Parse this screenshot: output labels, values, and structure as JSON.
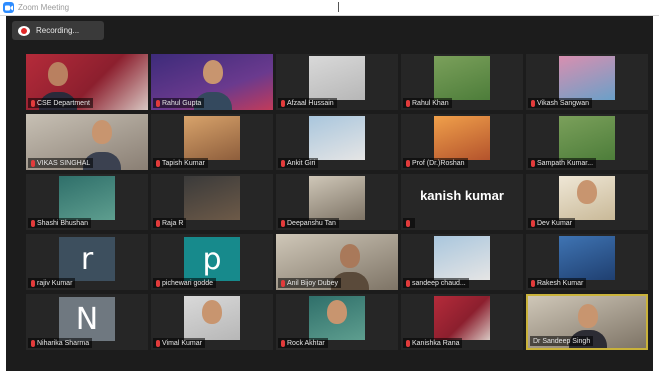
{
  "window": {
    "title": "Zoom Meeting"
  },
  "recording": {
    "label": "Recording..."
  },
  "participants": [
    {
      "name": "CSE Department"
    },
    {
      "name": "Rahul Gupta"
    },
    {
      "name": "Afzaal Hussain"
    },
    {
      "name": "Rahul Khan"
    },
    {
      "name": "Vikash Sangwan"
    },
    {
      "name": "VIKAS SINGHAL"
    },
    {
      "name": "Tapish Kumar"
    },
    {
      "name": "Ankit Giri"
    },
    {
      "name": "Prof (Dr.)Roshan"
    },
    {
      "name": "Sampath Kumar..."
    },
    {
      "name": "Shashi Bhushan"
    },
    {
      "name": "Raja R"
    },
    {
      "name": "Deepanshu Tan"
    },
    {
      "name": "",
      "display_text": "kanish kumar"
    },
    {
      "name": "Dev Kumar"
    },
    {
      "name": "rajiv Kumar",
      "initial": "r"
    },
    {
      "name": "pichewari godde",
      "initial": "p"
    },
    {
      "name": "Anil Bijoy Dubey"
    },
    {
      "name": "sandeep chaud..."
    },
    {
      "name": "Rakesh Kumar"
    },
    {
      "name": "Niharika Sharma",
      "initial": "N"
    },
    {
      "name": "Vimal Kumar"
    },
    {
      "name": "Rock Akhtar"
    },
    {
      "name": "Kanishka Rana"
    },
    {
      "name": "Dr Sandeep Singh"
    }
  ],
  "colors": {
    "stage": "#1c1c1c",
    "active_speaker_border": "#c9b23a",
    "muted_mic": "#e23b3b",
    "avatar_r": "#3d4f5e",
    "avatar_p": "#178a8c",
    "avatar_N": "#6f7880"
  }
}
